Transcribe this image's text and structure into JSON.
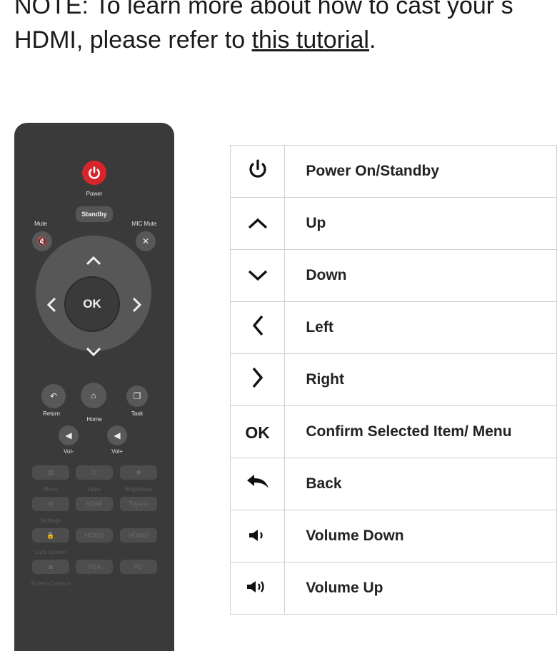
{
  "note": {
    "text_before": "NOTE: To learn more about how to cast your s",
    "line2_before": "HDMI, please refer to ",
    "link": "this tutorial",
    "after": "."
  },
  "remote": {
    "power_label": "Power",
    "standby": "Standby",
    "mute": "Mute",
    "mic_mute": "MIC Mute",
    "ok": "OK",
    "return": "Return",
    "home": "Home",
    "task": "Task",
    "vol_down": "Vol-",
    "vol_up": "Vol+",
    "menu": "Menu",
    "apps": "Apps",
    "brightness": "Brightness",
    "settings": "Settings",
    "hdmi": "HDMI",
    "typec": "Type-c",
    "lock_screen": "Lock Screen",
    "hdmi1": "HDMI1",
    "hdmi2": "HDMI2",
    "screen_capture": "Screen Capture",
    "vga": "VGA",
    "pc": "PC"
  },
  "legend": [
    {
      "icon": "power-icon",
      "symbol": "⏻",
      "label": "Power On/Standby"
    },
    {
      "icon": "chevron-up-icon",
      "symbol": "^",
      "label": "Up"
    },
    {
      "icon": "chevron-down-icon",
      "symbol": "v",
      "label": "Down"
    },
    {
      "icon": "chevron-left-icon",
      "symbol": "<",
      "label": "Left"
    },
    {
      "icon": "chevron-right-icon",
      "symbol": ">",
      "label": "Right"
    },
    {
      "icon": "ok-icon",
      "symbol": "OK",
      "label": "Confirm Selected Item/ Menu"
    },
    {
      "icon": "back-arrow-icon",
      "symbol": "↰",
      "label": "Back"
    },
    {
      "icon": "volume-down-icon",
      "symbol": "◀)",
      "label": "Volume Down"
    },
    {
      "icon": "volume-up-icon",
      "symbol": "◀))",
      "label": "Volume Up"
    }
  ]
}
